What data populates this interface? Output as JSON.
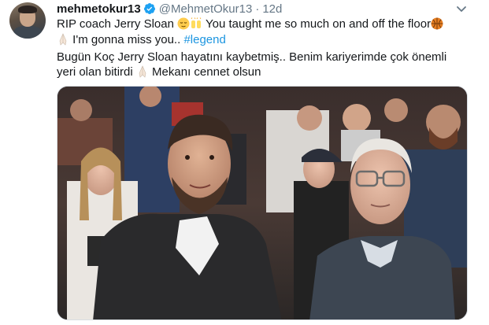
{
  "tweet": {
    "display_name": "mehmetokur13",
    "handle": "@MehmetOkur13",
    "separator": "·",
    "timestamp": "12d",
    "line1_text": "RIP coach Jerry Sloan ",
    "line1_text_after": " You taught me so much on and off the floor",
    "line2_text": " I'm gonna miss you.. ",
    "hashtag": "#legend",
    "line3_text": "Bugün Koç Jerry Sloan hayatını kaybetmiş.. Benim kariyerimde çok önemli",
    "line4_text": "yeri olan bitirdi ",
    "line4_text_after": " Mekanı cennet olsun",
    "icons": [
      "verified-badge-icon",
      "chevron-down-icon",
      "relieved-face-emoji",
      "raised-hands-emoji",
      "basketball-emoji",
      "folded-hands-emoji"
    ]
  },
  "colors": {
    "link": "#1b95e0",
    "verified": "#1da1f2",
    "secondary_text": "#657786",
    "primary_text": "#14171a"
  }
}
